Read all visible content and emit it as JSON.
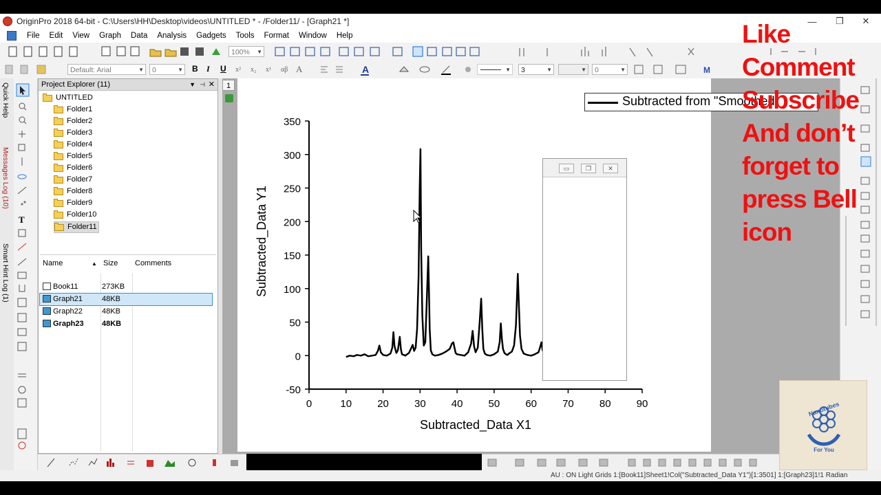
{
  "window": {
    "title": "OriginPro 2018 64-bit - C:\\Users\\HH\\Desktop\\videos\\UNTITLED * - /Folder11/ - [Graph21 *]",
    "controls": [
      "—",
      "❐",
      "✕"
    ]
  },
  "menu": [
    "File",
    "Edit",
    "View",
    "Graph",
    "Data",
    "Analysis",
    "Gadgets",
    "Tools",
    "Format",
    "Window",
    "Help"
  ],
  "toolbar": {
    "zoom": "100%",
    "font": "Default: Arial",
    "font_size": "0",
    "bold": "B",
    "italic": "I",
    "underline": "U",
    "line_width": "3",
    "value_zero": "0"
  },
  "side_tabs": [
    "Quick Help",
    "Messages Log (10)",
    "Smart Hint Log (1)"
  ],
  "project_explorer": {
    "title": "Project Explorer (11)",
    "root": "UNTITLED",
    "folders": [
      "Folder1",
      "Folder2",
      "Folder3",
      "Folder4",
      "Folder5",
      "Folder6",
      "Folder7",
      "Folder8",
      "Folder9",
      "Folder10",
      "Folder11"
    ],
    "selected_folder": "Folder11",
    "columns": {
      "name": "Name",
      "size": "Size",
      "comments": "Comments"
    },
    "files": [
      {
        "name": "Book11",
        "size": "273KB",
        "comments": "",
        "kind": "book"
      },
      {
        "name": "Graph21",
        "size": "48KB",
        "comments": "",
        "kind": "graph",
        "selected": true
      },
      {
        "name": "Graph22",
        "size": "48KB",
        "comments": "",
        "kind": "graph"
      },
      {
        "name": "Graph23",
        "size": "48KB",
        "comments": "",
        "kind": "graph",
        "bold": true
      }
    ]
  },
  "page_tab": "1",
  "graph": {
    "legend": "Subtracted from \"Smoothed",
    "series_color": "#000000"
  },
  "chart_data": {
    "type": "line",
    "xlabel": "Subtracted_Data X1",
    "ylabel": "Subtracted_Data Y1",
    "xlim": [
      0,
      90
    ],
    "ylim": [
      -50,
      350
    ],
    "xticks": [
      0,
      10,
      20,
      30,
      40,
      50,
      60,
      70,
      80,
      90
    ],
    "yticks": [
      -50,
      0,
      50,
      100,
      150,
      200,
      250,
      300,
      350
    ],
    "series": [
      {
        "x": [
          10,
          11,
          12,
          13,
          14,
          15,
          16,
          17,
          18,
          18.6,
          19.0,
          19.4,
          20,
          21,
          22,
          22.5,
          22.8,
          23.1,
          23.6,
          24,
          24.5,
          24.8,
          25.1,
          25.6,
          26,
          27,
          28,
          28.4,
          28.8,
          29.2,
          29.6,
          29.9,
          30.1,
          30.3,
          30.6,
          31,
          31.4,
          31.8,
          32.2,
          32.4,
          32.6,
          32.9,
          33.3,
          34,
          35,
          36,
          37,
          38,
          38.6,
          39.0,
          39.3,
          39.6,
          40,
          41,
          42,
          43,
          43.8,
          44.2,
          44.6,
          45,
          45.6,
          46.1,
          46.5,
          46.8,
          47.1,
          47.5,
          48,
          49,
          50,
          51,
          51.5,
          51.8,
          52.1,
          52.4,
          52.8,
          53.2,
          53.6,
          54,
          54.8,
          55.4,
          55.9,
          56.2,
          56.4,
          56.7,
          57.0,
          57.4,
          58,
          59,
          60,
          61,
          62,
          62.5,
          62.8,
          63.1,
          63.5,
          64,
          64.3,
          64.6,
          64.9,
          65.2,
          65.6,
          66,
          66.4,
          67,
          67.5,
          67.8,
          68.1,
          68.5,
          69,
          70,
          71,
          72,
          73,
          74,
          75,
          75.6,
          76,
          76.4,
          76.8,
          77.2,
          77.4,
          77.6,
          77.9,
          78.2,
          78.6,
          79,
          80
        ],
        "y": [
          -2,
          0,
          -1,
          1,
          0,
          2,
          -1,
          0,
          1,
          7,
          15,
          5,
          1,
          0,
          3,
          12,
          35,
          14,
          4,
          8,
          28,
          10,
          2,
          1,
          0,
          4,
          16,
          7,
          12,
          40,
          120,
          250,
          308,
          160,
          60,
          15,
          20,
          80,
          148,
          100,
          40,
          8,
          2,
          0,
          1,
          3,
          6,
          10,
          18,
          20,
          12,
          4,
          2,
          1,
          0,
          5,
          18,
          37,
          14,
          5,
          12,
          50,
          85,
          40,
          10,
          3,
          1,
          0,
          2,
          6,
          20,
          48,
          25,
          10,
          4,
          2,
          1,
          3,
          6,
          15,
          45,
          90,
          122,
          75,
          30,
          10,
          3,
          1,
          0,
          2,
          5,
          14,
          20,
          8,
          4,
          12,
          60,
          120,
          60,
          15,
          5,
          14,
          3,
          6,
          12,
          20,
          8,
          2,
          1,
          0,
          -1,
          1,
          2,
          3,
          5,
          10,
          15,
          8,
          40,
          160,
          163,
          60,
          15,
          1,
          0,
          -2,
          0
        ]
      }
    ]
  },
  "bottom_status": "AU : ON  Light Grids  1:[Book11]Sheet1!Col(\"Subtracted_Data Y1\")[1:3501]  1:[Graph23]1!1  Radian",
  "overlay": {
    "lines": [
      "Like",
      "Comment",
      "Subscribe",
      "And don’t",
      "forget to",
      "press Bell",
      "icon"
    ],
    "color": "#ee1111"
  },
  "logo": {
    "text_top": "Nanotubes",
    "text_bottom": "For You"
  }
}
